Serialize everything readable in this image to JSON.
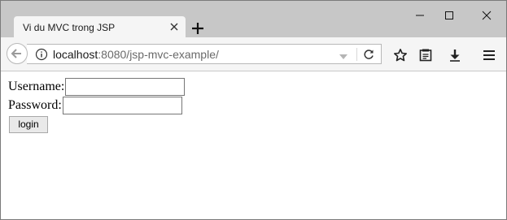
{
  "browser": {
    "tab_title": "Vi du MVC trong JSP",
    "url_host": "localhost",
    "url_rest": ":8080/jsp-mvc-example/",
    "icons": {
      "tab_close": "close-icon",
      "new_tab": "plus-icon",
      "minimize": "minimize-icon",
      "maximize": "maximize-icon",
      "close": "close-icon",
      "back": "back-arrow-icon",
      "info": "info-icon",
      "dropdown": "dropdown-arrow-icon",
      "reload": "reload-icon",
      "bookmark": "star-icon",
      "reader": "reader-view-icon",
      "download": "download-icon",
      "menu": "hamburger-menu-icon"
    }
  },
  "form": {
    "username_label": "Username:",
    "username_value": "",
    "password_label": "Password:",
    "password_value": "",
    "login_label": "login"
  },
  "colors": {
    "titlebar": "#c7c7c7",
    "toolbar": "#f5f5f5",
    "tab": "#f5f5f5"
  }
}
